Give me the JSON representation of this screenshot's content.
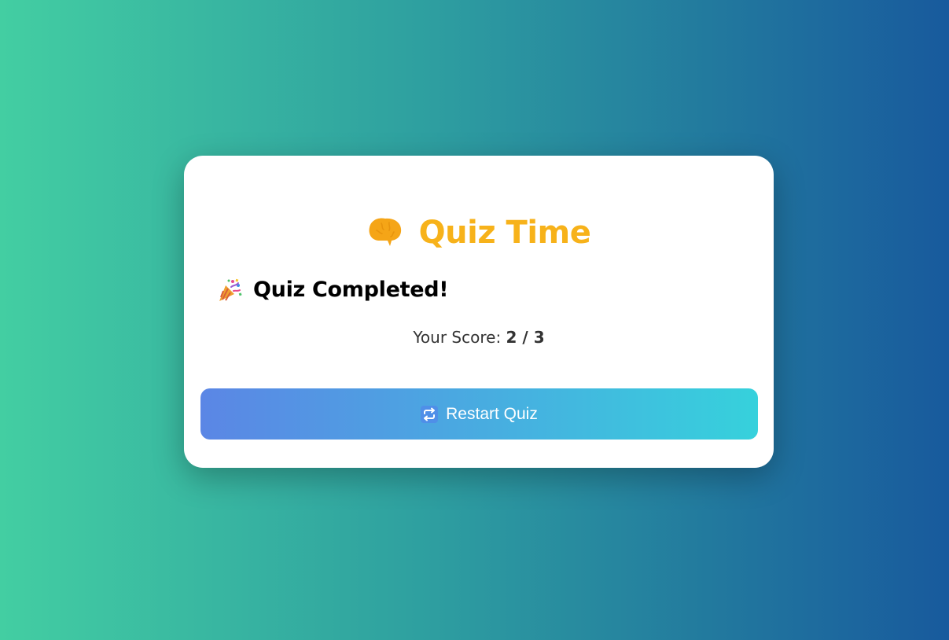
{
  "header": {
    "title": "Quiz Time",
    "icon": "brain-icon"
  },
  "result": {
    "heading": "Quiz Completed!",
    "icon": "party-popper-icon",
    "score_label": "Your Score:",
    "score_value": "2 / 3"
  },
  "actions": {
    "restart_label": "Restart Quiz",
    "restart_icon": "repeat-icon"
  },
  "colors": {
    "title": "#f7b21a",
    "button_start": "#5b86e5",
    "button_end": "#36d1dc",
    "background_start": "#43cea2",
    "background_end": "#185a9d"
  }
}
